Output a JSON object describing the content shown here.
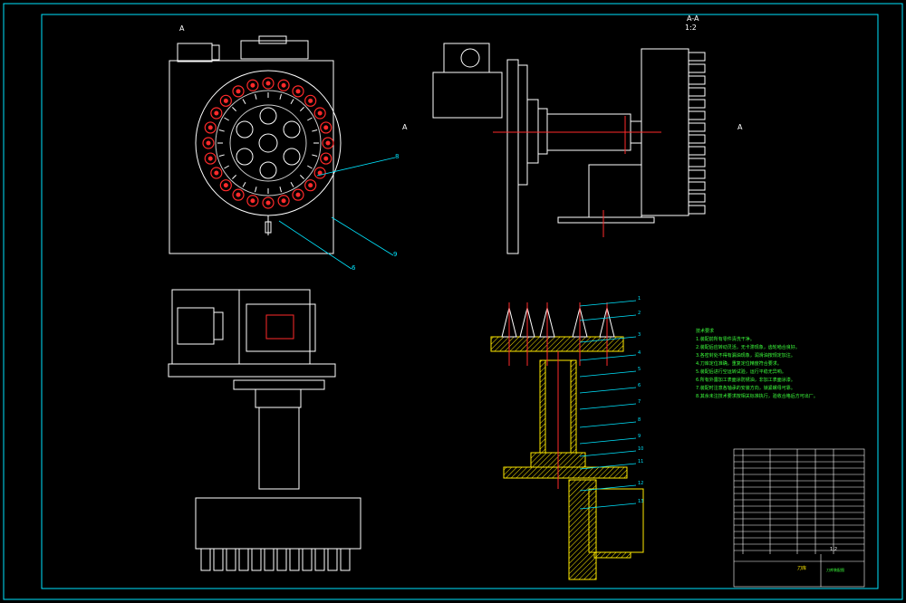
{
  "view_labels": {
    "arrow_a_top": "A",
    "arrow_a_right1": "A",
    "arrow_a_right2": "A",
    "section_title": "A-A",
    "section_scale": "1:2"
  },
  "leaders": {
    "plan_callouts": [
      "8",
      "9",
      "6"
    ],
    "section_callouts": [
      "1",
      "2",
      "3",
      "4",
      "5",
      "6",
      "7",
      "8",
      "9",
      "10",
      "11",
      "12",
      "13"
    ]
  },
  "technical_notes": [
    "技术要求",
    "1.装配前所有零件清洗干净。",
    "2.装配后应转动灵活，无卡滞现象，齿轮啮合良好。",
    "3.各密封处不得有漏油现象，润滑油按规定加注。",
    "4.刀库定位准确，重复定位精度符合要求。",
    "5.装配后进行空运转试验，运行平稳无异响。",
    "6.所有外露加工表面涂防锈油，非加工表面涂漆。",
    "7.装配时注意各轴承的安装方向，锁紧螺母可靠。",
    "8.其余未注技术要求按相关标准执行，验收合格后方可出厂。"
  ],
  "title_block": {
    "drawing_title": "刀库",
    "drawing_name": "刀库装配图",
    "scale": "1:2"
  },
  "colors": {
    "frame": "#00e5ff",
    "outline": "#ffffff",
    "pocket": "#ff2a2a",
    "center": "#ff2a2a",
    "section_fill": "#ffea00",
    "notes": "#3cff3c",
    "leader": "#00e5ff"
  }
}
